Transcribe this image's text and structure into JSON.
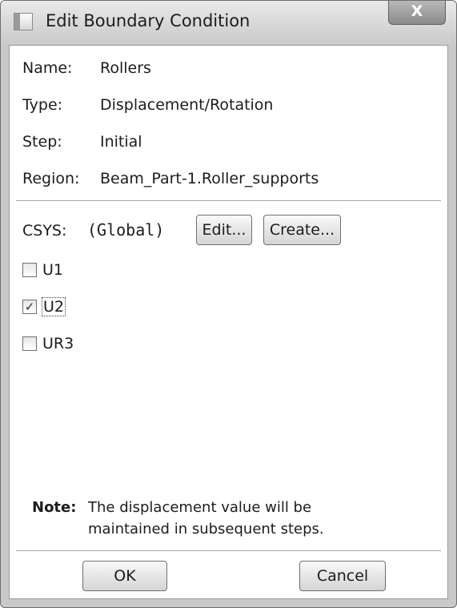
{
  "window": {
    "title": "Edit Boundary Condition",
    "close_glyph": "X"
  },
  "fields": [
    {
      "label": "Name:",
      "value": "Rollers"
    },
    {
      "label": "Type:",
      "value": "Displacement/Rotation"
    },
    {
      "label": "Step:",
      "value": "Initial"
    },
    {
      "label": "Region:",
      "value": "Beam_Part-1.Roller_supports"
    }
  ],
  "csys": {
    "label": "CSYS:",
    "value": "(Global)",
    "edit_label": "Edit...",
    "create_label": "Create..."
  },
  "dofs": [
    {
      "label": "U1",
      "checked": false
    },
    {
      "label": "U2",
      "checked": true
    },
    {
      "label": "UR3",
      "checked": false
    }
  ],
  "note": {
    "label": "Note:",
    "line1": "The displacement value will be",
    "line2": "maintained in subsequent steps."
  },
  "buttons": {
    "ok": "OK",
    "cancel": "Cancel"
  },
  "icons": {
    "window_icon": "dialog-window-icon",
    "check_mark": "✓"
  }
}
